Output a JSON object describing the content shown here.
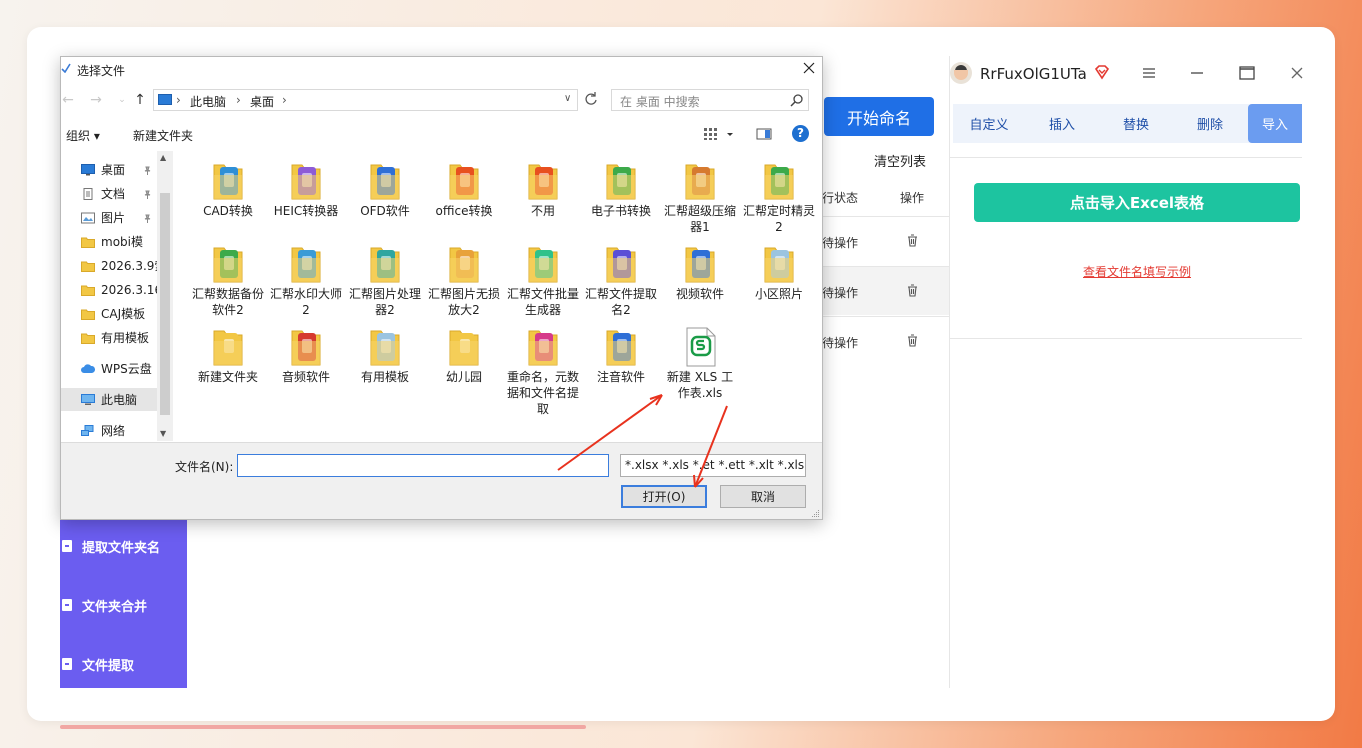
{
  "app": {
    "sidebar": [
      {
        "label": "提取文件夹名"
      },
      {
        "label": "文件夹合并"
      },
      {
        "label": "文件提取"
      }
    ],
    "start_button": "开始命名",
    "clear_list": "清空列表",
    "columns": {
      "status": "行状态",
      "operation": "操作"
    },
    "rows": [
      {
        "status": "待操作"
      },
      {
        "status": "待操作"
      },
      {
        "status": "待操作"
      }
    ],
    "user": {
      "name": "RrFuxOlG1UTa"
    },
    "tabs": [
      {
        "label": "自定义"
      },
      {
        "label": "插入"
      },
      {
        "label": "替换"
      },
      {
        "label": "删除"
      },
      {
        "label": "导入",
        "active": true
      }
    ],
    "import_button": "点击导入Excel表格",
    "example_link": "查看文件名填写示例",
    "colors": {
      "sidebar": "#6b5df0",
      "start": "#1f6fe6",
      "import": "#1dc4a0",
      "link": "#e43a32",
      "tab_active": "#6b9cf0"
    }
  },
  "dialog": {
    "title": "选择文件",
    "address": {
      "segments": [
        "此电脑",
        "桌面"
      ]
    },
    "search_placeholder": "在 桌面 中搜索",
    "toolbar": {
      "organize": "组织 ▾",
      "new_folder": "新建文件夹"
    },
    "nav": [
      {
        "label": "桌面",
        "icon": "desktop-icon",
        "pinned": true
      },
      {
        "label": "文档",
        "icon": "document-icon",
        "pinned": true
      },
      {
        "label": "图片",
        "icon": "picture-icon",
        "pinned": true
      },
      {
        "label": "mobi模",
        "icon": "folder-icon"
      },
      {
        "label": "2026.3.9索",
        "icon": "folder-icon"
      },
      {
        "label": "2026.3.16.",
        "icon": "folder-icon"
      },
      {
        "label": "CAJ模板",
        "icon": "folder-icon"
      },
      {
        "label": "有用模板",
        "icon": "folder-icon"
      },
      {
        "label": "WPS云盘",
        "icon": "cloud-icon"
      },
      {
        "label": "此电脑",
        "icon": "pc-icon",
        "selected": true
      },
      {
        "label": "网络",
        "icon": "network-icon"
      }
    ],
    "files": [
      {
        "label": "CAD转换",
        "color": "#2f8fd6"
      },
      {
        "label": "HEIC转换器",
        "color": "#8d5bd6"
      },
      {
        "label": "OFD软件",
        "color": "#2f6fd6"
      },
      {
        "label": "office转换",
        "color": "#e8501f"
      },
      {
        "label": "不用",
        "color": "#e8501f"
      },
      {
        "label": "电子书转换",
        "color": "#3caa4a"
      },
      {
        "label": "汇帮超级压缩器1",
        "color": "#d67a2f"
      },
      {
        "label": "汇帮定时精灵2",
        "color": "#3caa4a"
      },
      {
        "label": "汇帮数据备份软件2",
        "color": "#3caa4a"
      },
      {
        "label": "汇帮水印大师2",
        "color": "#3a9bd6"
      },
      {
        "label": "汇帮图片处理器2",
        "color": "#2fa6a0"
      },
      {
        "label": "汇帮图片无损放大2",
        "color": "#e8a23a"
      },
      {
        "label": "汇帮文件批量生成器",
        "color": "#2fc28a"
      },
      {
        "label": "汇帮文件提取名2",
        "color": "#5b4fd6"
      },
      {
        "label": "视频软件",
        "color": "#2f6fd6"
      },
      {
        "label": "小区照片",
        "color": "#9bc4e0"
      },
      {
        "label": "新建文件夹",
        "color": "#f2c744"
      },
      {
        "label": "音频软件",
        "color": "#d63a2f"
      },
      {
        "label": "有用模板",
        "color": "#9bc4e0"
      },
      {
        "label": "幼儿园",
        "color": "#f2c744"
      },
      {
        "label": "重命名，元数据和文件名提取",
        "color": "#d63a8a"
      },
      {
        "label": "注音软件",
        "color": "#2f6fd6"
      },
      {
        "label": "新建 XLS 工作表.xls",
        "color": "#1a9b47",
        "type": "xls"
      }
    ],
    "filename_label": "文件名(N):",
    "filename_value": "",
    "filetype": "*.xlsx *.xls *.et *.ett *.xlt *.xlsm",
    "open_button": "打开(O)",
    "cancel_button": "取消"
  }
}
